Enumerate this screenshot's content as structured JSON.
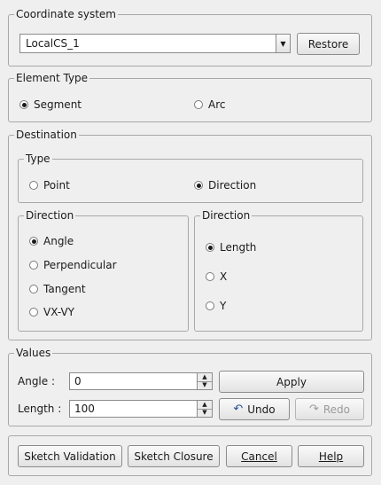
{
  "coordinate_system": {
    "title": "Coordinate system",
    "selected": "LocalCS_1",
    "restore_label": "Restore"
  },
  "element_type": {
    "title": "Element Type",
    "options": [
      "Segment",
      "Arc"
    ],
    "selected": "Segment"
  },
  "destination": {
    "title": "Destination",
    "type": {
      "title": "Type",
      "options": [
        "Point",
        "Direction"
      ],
      "selected": "Direction"
    },
    "direction_left": {
      "title": "Direction",
      "options": [
        "Angle",
        "Perpendicular",
        "Tangent",
        "VX-VY"
      ],
      "selected": "Angle"
    },
    "direction_right": {
      "title": "Direction",
      "options": [
        "Length",
        "X",
        "Y"
      ],
      "selected": "Length"
    }
  },
  "values": {
    "title": "Values",
    "angle_label": "Angle :",
    "angle_value": "0",
    "length_label": "Length :",
    "length_value": "100",
    "apply_label": "Apply",
    "undo_label": "Undo",
    "redo_label": "Redo"
  },
  "footer": {
    "validation_label": "Sketch Validation",
    "closure_label": "Sketch Closure",
    "cancel_label": "Cancel",
    "help_label": "Help"
  },
  "icons": {
    "undo": "undo-arrow-icon",
    "redo": "redo-arrow-icon",
    "dropdown": "chevron-down-icon",
    "spin_up": "spin-up-icon",
    "spin_down": "spin-down-icon"
  }
}
